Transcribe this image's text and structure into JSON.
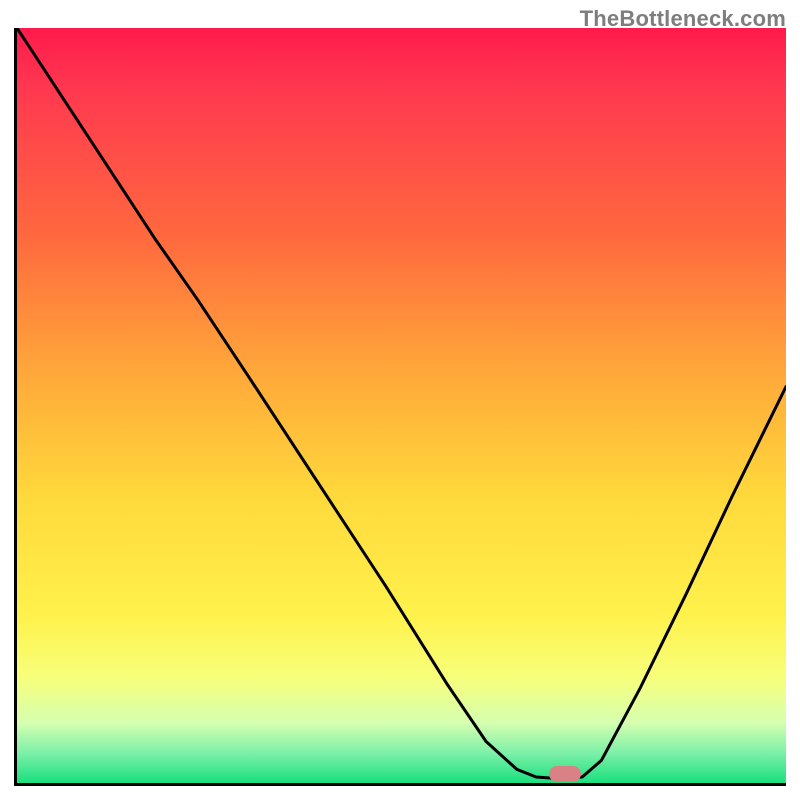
{
  "watermark": "TheBottleneck.com",
  "plot": {
    "inner_width": 769,
    "inner_height": 755
  },
  "chart_data": {
    "type": "line",
    "title": "",
    "xlabel": "",
    "ylabel": "",
    "xlim_frac": [
      0,
      1
    ],
    "ylim_frac": [
      0,
      1
    ],
    "series": [
      {
        "name": "bottleneck-curve",
        "xy_frac": [
          [
            0.0,
            1.0
          ],
          [
            0.09,
            0.86
          ],
          [
            0.18,
            0.72
          ],
          [
            0.235,
            0.64
          ],
          [
            0.3,
            0.54
          ],
          [
            0.39,
            0.4
          ],
          [
            0.48,
            0.26
          ],
          [
            0.56,
            0.13
          ],
          [
            0.61,
            0.055
          ],
          [
            0.65,
            0.018
          ],
          [
            0.675,
            0.008
          ],
          [
            0.702,
            0.006
          ],
          [
            0.735,
            0.008
          ],
          [
            0.76,
            0.03
          ],
          [
            0.81,
            0.125
          ],
          [
            0.87,
            0.25
          ],
          [
            0.93,
            0.38
          ],
          [
            1.0,
            0.525
          ]
        ]
      }
    ],
    "marker": {
      "name": "optimal-point",
      "xy_frac": [
        0.712,
        0.012
      ]
    },
    "gradient_stops": [
      {
        "offset": 0.0,
        "color": "#ff1a4b"
      },
      {
        "offset": 0.3,
        "color": "#ff8a3e"
      },
      {
        "offset": 0.6,
        "color": "#ffe03c"
      },
      {
        "offset": 0.85,
        "color": "#f4ff78"
      },
      {
        "offset": 1.0,
        "color": "#19e07e"
      }
    ]
  }
}
